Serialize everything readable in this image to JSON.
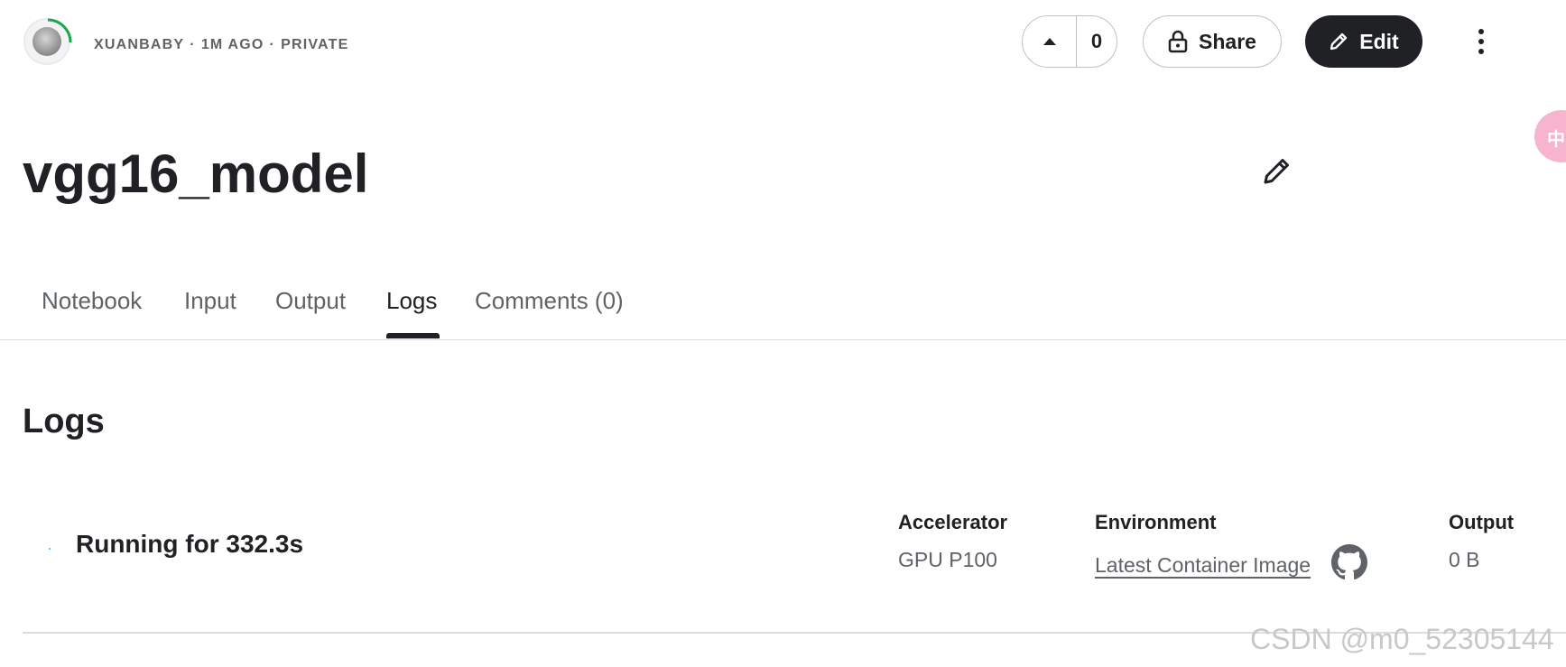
{
  "header": {
    "author": "XUANBABY",
    "time_ago": "1M AGO",
    "visibility": "PRIVATE",
    "separator": "·",
    "vote_count": "0",
    "share_label": "Share",
    "edit_label": "Edit",
    "bubble_text": "中"
  },
  "title": "vgg16_model",
  "tabs": [
    {
      "label": "Notebook"
    },
    {
      "label": "Input"
    },
    {
      "label": "Output"
    },
    {
      "label": "Logs"
    },
    {
      "label": "Comments (0)"
    }
  ],
  "active_tab": "Logs",
  "logs": {
    "heading": "Logs",
    "status": "Running for 332.3s",
    "accelerator_label": "Accelerator",
    "accelerator_value": "GPU P100",
    "environment_label": "Environment",
    "environment_value": "Latest Container Image",
    "output_label": "Output",
    "output_value": "0 B"
  },
  "watermark": "CSDN @m0_52305144",
  "colors": {
    "primary_dark": "#202124",
    "muted": "#5f6368",
    "border": "#dadce0",
    "progress_ring": "#1aa64b",
    "bubble": "#f7b4cf"
  },
  "icons": {
    "avatar": "duck-avatar",
    "upvote": "caret-up-icon",
    "share": "lock-icon",
    "edit": "pencil-icon",
    "more": "more-vert-icon",
    "environment": "github-icon"
  }
}
